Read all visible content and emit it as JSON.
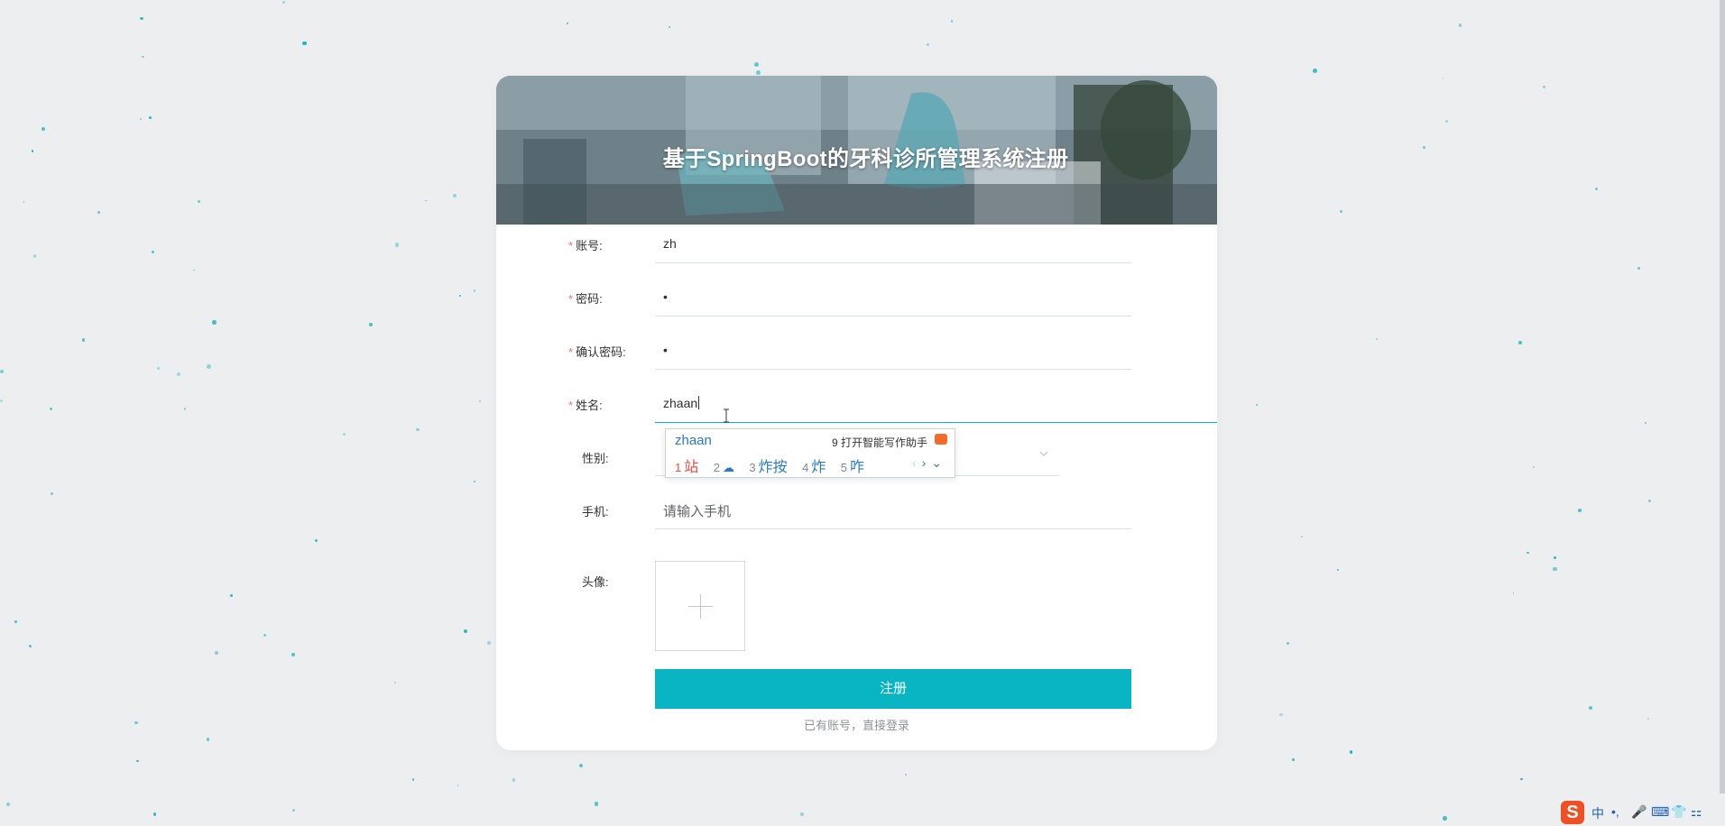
{
  "page": {
    "title": "基于SpringBoot的牙科诊所管理系统注册",
    "accent_color": "#0ab5c3",
    "required_color": "#f56c6c"
  },
  "form": {
    "account": {
      "label": "账号:",
      "value": "zh",
      "required": true
    },
    "password": {
      "label": "密码:",
      "value": "•",
      "required": true
    },
    "confirm_password": {
      "label": "确认密码:",
      "value": "•",
      "required": true
    },
    "name": {
      "label": "姓名:",
      "value": "zhaan",
      "required": true
    },
    "gender": {
      "label": "性别:",
      "value": "",
      "required": false,
      "icon": "chevron-down-icon"
    },
    "phone": {
      "label": "手机:",
      "placeholder": "请输入手机",
      "required": false
    },
    "avatar": {
      "label": "头像:",
      "icon": "plus-icon"
    },
    "submit_label": "注册",
    "login_link": "已有账号，直接登录"
  },
  "ime": {
    "composition": "zhaan",
    "assistant": "9 打开智能写作助手",
    "candidates": [
      {
        "num": "1",
        "text": "站"
      },
      {
        "num": "2",
        "text": ""
      },
      {
        "num": "3",
        "text": "炸按"
      },
      {
        "num": "4",
        "text": "炸"
      },
      {
        "num": "5",
        "text": "咋"
      }
    ],
    "nav": {
      "prev": "‹",
      "next": "›",
      "more": "⌄"
    }
  },
  "tray": {
    "logo": "S",
    "items": [
      "中",
      "•,",
      "🎤",
      "⌨",
      "👕",
      "⚏"
    ]
  }
}
